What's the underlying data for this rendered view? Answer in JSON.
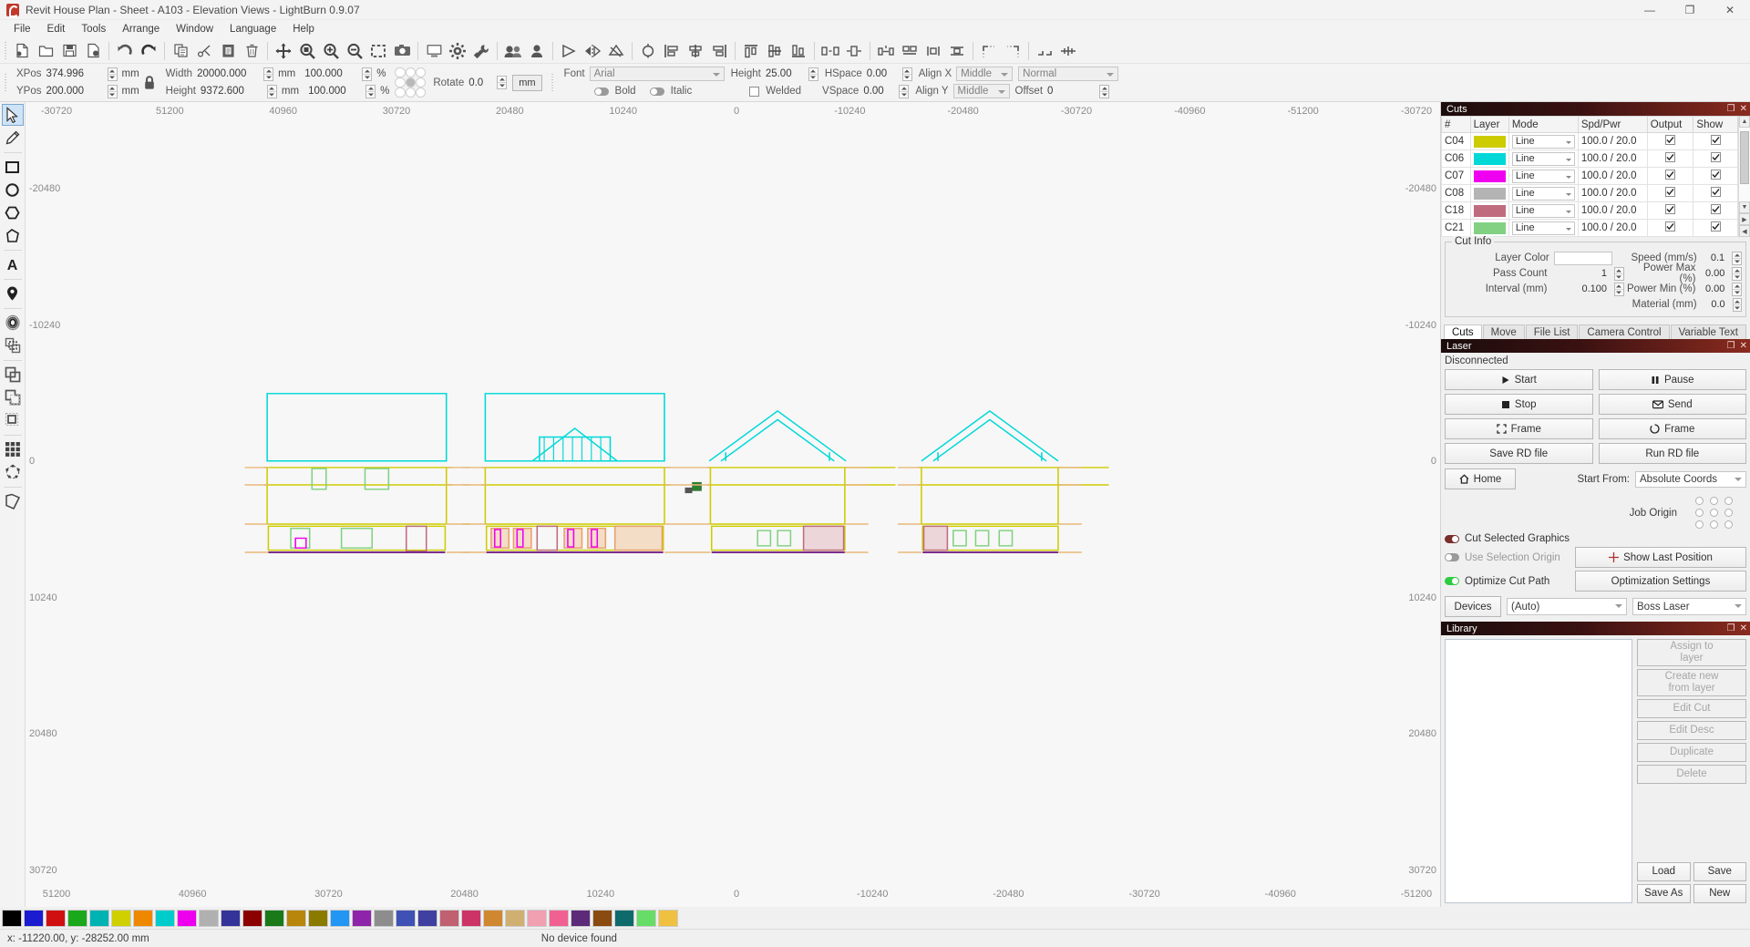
{
  "window": {
    "title": "Revit House Plan - Sheet - A103 - Elevation Views - LightBurn 0.9.07",
    "minimize": "—",
    "maximize": "❐",
    "close": "✕"
  },
  "menu": [
    "File",
    "Edit",
    "Tools",
    "Arrange",
    "Window",
    "Language",
    "Help"
  ],
  "toolbar_icons": [
    "new-file-icon",
    "open-file-icon",
    "save-icon",
    "export-icon",
    "undo-icon",
    "redo-icon",
    "copy-icon",
    "cut-icon",
    "paste-icon",
    "delete-icon",
    "move-icon",
    "zoom-fit-icon",
    "zoom-in-icon",
    "zoom-out-icon",
    "zoom-selection-icon",
    "frame-preview-icon",
    "preview-icon",
    "settings-icon",
    "device-settings-icon",
    "group-icon",
    "ungroup-icon",
    "node-edit-icon",
    "mirror-horizontal-icon",
    "mirror-vertical-icon",
    "weld-icon",
    "align-left-icon",
    "align-center-h-icon",
    "align-right-icon",
    "align-top-icon",
    "align-middle-v-icon",
    "align-bottom-icon",
    "distribute-h-icon",
    "distribute-v-icon",
    "space-h-icon",
    "space-v-icon",
    "center-h-icon",
    "center-v-icon",
    "corner-tl-icon",
    "corner-tr-icon",
    "array-h-icon",
    "array-v-icon"
  ],
  "props": {
    "xpos_label": "XPos",
    "xpos_value": "374.996",
    "xpos_unit": "mm",
    "ypos_label": "YPos",
    "ypos_value": "200.000",
    "ypos_unit": "mm",
    "lock_icon": "lock-icon",
    "width_label": "Width",
    "width_value": "20000.000",
    "width_unit": "mm",
    "width_pct": "100.000",
    "pct_sym": "%",
    "height_label": "Height",
    "height_value": "9372.600",
    "height_unit": "mm",
    "height_pct": "100.000",
    "rotate_label": "Rotate",
    "rotate_value": "0.0",
    "unit_button": "mm",
    "font_label": "Font",
    "font_value": "Arial",
    "text_height_label": "Height",
    "text_height_value": "25.00",
    "hspace_label": "HSpace",
    "hspace_value": "0.00",
    "vspace_label": "VSpace",
    "vspace_value": "0.00",
    "align_x_label": "Align X",
    "align_x_value": "Middle",
    "align_y_label": "Align Y",
    "align_y_value": "Middle",
    "normal_value": "Normal",
    "offset_label": "Offset",
    "offset_value": "0",
    "bold_label": "Bold",
    "italic_label": "Italic",
    "welded_label": "Welded"
  },
  "lefttools": [
    {
      "name": "select-tool",
      "icon": "cursor-arrow-icon",
      "active": true
    },
    {
      "name": "edit-nodes-tool",
      "icon": "pencil-icon",
      "active": false
    },
    {
      "name": "rectangle-tool",
      "icon": "rectangle-icon",
      "active": false
    },
    {
      "name": "ellipse-tool",
      "icon": "ellipse-icon",
      "active": false
    },
    {
      "name": "polygon-tool",
      "icon": "polygon-icon",
      "active": false
    },
    {
      "name": "draw-polyline-tool",
      "icon": "freehand-polygon-icon",
      "active": false
    },
    {
      "name": "text-tool",
      "icon": "letter-a-icon",
      "active": false
    },
    {
      "name": "position-tool",
      "icon": "map-pin-icon",
      "active": false
    },
    {
      "name": "offset-shapes-tool",
      "icon": "offset-rings-icon",
      "active": false
    },
    {
      "name": "array-tool",
      "icon": "array-grid-icon",
      "active": false
    },
    {
      "name": "boolean-union-tool",
      "icon": "boolean-union-icon",
      "active": false
    },
    {
      "name": "boolean-subtract-tool",
      "icon": "boolean-subtract-icon",
      "active": false
    },
    {
      "name": "boolean-intersect-tool",
      "icon": "boolean-intersect-icon",
      "active": false
    },
    {
      "name": "grid-array-tool",
      "icon": "grid-icon",
      "active": false
    },
    {
      "name": "circular-array-tool",
      "icon": "circular-array-icon",
      "active": false
    },
    {
      "name": "print-cut-tool",
      "icon": "print-and-cut-icon",
      "active": false
    }
  ],
  "canvas": {
    "ruler_top": [
      "-30720",
      "51200",
      "40960",
      "30720",
      "20480",
      "10240",
      "0",
      "-10240",
      "-20480",
      "-30720",
      "-40960",
      "-51200",
      "-30720"
    ],
    "ruler_bottom": [
      "51200",
      "40960",
      "30720",
      "20480",
      "10240",
      "0",
      "-10240",
      "-20480",
      "-30720",
      "-40960",
      "-51200"
    ],
    "ruler_left": [
      "-20480",
      "-10240",
      "0",
      "10240",
      "20480",
      "30720"
    ],
    "ruler_right": [
      "-20480",
      "-10240",
      "0",
      "10240",
      "20480",
      "30720"
    ]
  },
  "cuts_panel": {
    "title": "Cuts",
    "float_icon": "float-panel-icon",
    "close_icon": "close-panel-icon",
    "columns": [
      "#",
      "Layer",
      "Mode",
      "Spd/Pwr",
      "Output",
      "Show"
    ],
    "rows": [
      {
        "id": "C04",
        "color": "#cdcc00",
        "mode": "Line",
        "spdpwr": "100.0 / 20.0",
        "output": true,
        "show": true
      },
      {
        "id": "C06",
        "color": "#00d8d8",
        "mode": "Line",
        "spdpwr": "100.0 / 20.0",
        "output": true,
        "show": true
      },
      {
        "id": "C07",
        "color": "#f000f0",
        "mode": "Line",
        "spdpwr": "100.0 / 20.0",
        "output": true,
        "show": true
      },
      {
        "id": "C08",
        "color": "#b4b4b4",
        "mode": "Line",
        "spdpwr": "100.0 / 20.0",
        "output": true,
        "show": true
      },
      {
        "id": "C18",
        "color": "#bf6c7e",
        "mode": "Line",
        "spdpwr": "100.0 / 20.0",
        "output": true,
        "show": true
      },
      {
        "id": "C21",
        "color": "#82d182",
        "mode": "Line",
        "spdpwr": "100.0 / 20.0",
        "output": true,
        "show": true
      }
    ]
  },
  "cut_info": {
    "title": "Cut Info",
    "layer_color_label": "Layer Color",
    "layer_color_value": "",
    "speed_label": "Speed (mm/s)",
    "speed_value": "0.1",
    "pass_count_label": "Pass Count",
    "pass_count_value": "1",
    "power_max_label": "Power Max (%)",
    "power_max_value": "0.00",
    "interval_label": "Interval (mm)",
    "interval_value": "0.100",
    "power_min_label": "Power Min (%)",
    "power_min_value": "0.00",
    "material_label": "Material (mm)",
    "material_value": "0.0"
  },
  "dock_tabs": [
    {
      "label": "Cuts",
      "active": true
    },
    {
      "label": "Move",
      "active": false
    },
    {
      "label": "File List",
      "active": false
    },
    {
      "label": "Camera Control",
      "active": false
    },
    {
      "label": "Variable Text",
      "active": false
    }
  ],
  "laser_panel": {
    "title": "Laser",
    "status": "Disconnected",
    "buttons": [
      {
        "label": "Start",
        "icon": "play-icon"
      },
      {
        "label": "Pause",
        "icon": "pause-icon"
      },
      {
        "label": "Stop",
        "icon": "stop-icon"
      },
      {
        "label": "Send",
        "icon": "send-icon"
      },
      {
        "label": "Frame",
        "icon": "frame-square-icon"
      },
      {
        "label": "Frame",
        "icon": "frame-round-icon"
      },
      {
        "label": "Save RD file",
        "icon": ""
      },
      {
        "label": "Run RD file",
        "icon": ""
      }
    ],
    "home_label": "Home",
    "home_icon": "home-icon",
    "start_from_label": "Start From:",
    "start_from_value": "Absolute Coords",
    "job_origin_label": "Job Origin",
    "cut_selected_label": "Cut Selected Graphics",
    "use_selection_origin_label": "Use Selection Origin",
    "optimize_cut_label": "Optimize Cut Path",
    "show_last_position_label": "Show Last Position",
    "optimization_settings_label": "Optimization Settings",
    "devices_label": "Devices",
    "device_auto_value": "(Auto)",
    "device_profile_value": "Boss Laser"
  },
  "library_panel": {
    "title": "Library",
    "buttons": [
      {
        "label": "Assign to layer",
        "disabled": true
      },
      {
        "label": "Create new from layer",
        "disabled": true
      },
      {
        "label": "Edit Cut",
        "disabled": true
      },
      {
        "label": "Edit Desc",
        "disabled": true
      },
      {
        "label": "Duplicate",
        "disabled": true
      },
      {
        "label": "Delete",
        "disabled": true
      },
      {
        "label": "Load",
        "disabled": false
      },
      {
        "label": "Save",
        "disabled": false
      },
      {
        "label": "Save As",
        "disabled": false
      },
      {
        "label": "New",
        "disabled": false
      }
    ]
  },
  "palette": [
    "#000000",
    "#1b1bd0",
    "#d01010",
    "#1ca81c",
    "#00b3b3",
    "#d0d000",
    "#ee8800",
    "#00cccc",
    "#ee00ee",
    "#b0b0b0",
    "#333399",
    "#8b0000",
    "#1a7a1a",
    "#b8860b",
    "#8a7a00",
    "#2196f3",
    "#8e24aa",
    "#8d8d8d",
    "#3f51b5",
    "#4040a0",
    "#c06070",
    "#cc3366",
    "#d08830",
    "#d0b070",
    "#f0a0b0",
    "#f06090",
    "#5d2a7a",
    "#8a4b10",
    "#0f6b6b",
    "#66dd66",
    "#f0c040"
  ],
  "statusbar": {
    "coords": "x: -11220.00, y: -28252.00 mm",
    "device": "No device found"
  }
}
